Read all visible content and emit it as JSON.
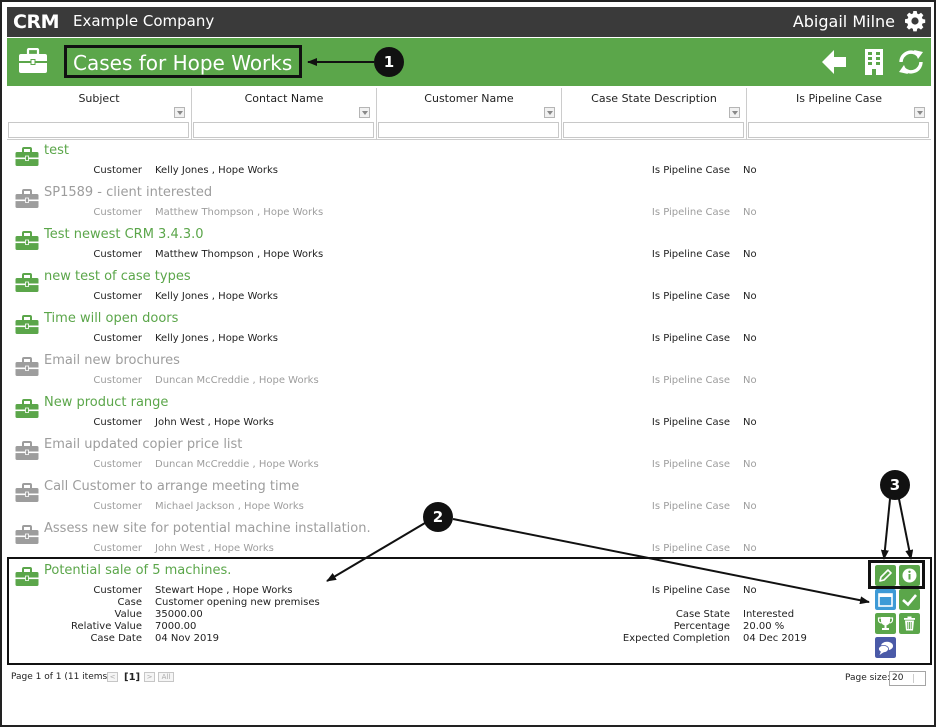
{
  "topbar": {
    "logo": "CRM",
    "company": "Example Company",
    "user": "Abigail Milne"
  },
  "header": {
    "title": "Cases for Hope Works"
  },
  "columns": [
    "Subject",
    "Contact Name",
    "Customer Name",
    "Case State Description",
    "Is Pipeline Case"
  ],
  "labels": {
    "customer": "Customer",
    "pipeline": "Is Pipeline Case",
    "case": "Case",
    "value": "Value",
    "relative_value": "Relative Value",
    "case_date": "Case Date",
    "case_state": "Case State",
    "percentage": "Percentage",
    "expected_completion": "Expected Completion"
  },
  "cases": [
    {
      "title": "test",
      "customer": "Kelly Jones , Hope Works",
      "pipeline": "No",
      "active": true
    },
    {
      "title": "SP1589 - client interested",
      "customer": "Matthew Thompson , Hope Works",
      "pipeline": "No",
      "active": false
    },
    {
      "title": "Test newest CRM 3.4.3.0",
      "customer": "Matthew Thompson , Hope Works",
      "pipeline": "No",
      "active": true
    },
    {
      "title": "new test of case types",
      "customer": "Kelly Jones , Hope Works",
      "pipeline": "No",
      "active": true
    },
    {
      "title": "Time will open doors",
      "customer": "Kelly Jones , Hope Works",
      "pipeline": "No",
      "active": true
    },
    {
      "title": "Email new brochures",
      "customer": "Duncan McCreddie , Hope Works",
      "pipeline": "No",
      "active": false
    },
    {
      "title": "New product range",
      "customer": "John West , Hope Works",
      "pipeline": "No",
      "active": true
    },
    {
      "title": "Email updated copier price list",
      "customer": "Duncan McCreddie , Hope Works",
      "pipeline": "No",
      "active": false
    },
    {
      "title": "Call Customer to arrange meeting time",
      "customer": "Michael Jackson , Hope Works",
      "pipeline": "No",
      "active": false
    },
    {
      "title": "Assess new site for potential machine installation.",
      "customer": "John West , Hope Works",
      "pipeline": "No",
      "active": false
    }
  ],
  "selected_case": {
    "title": "Potential sale of 5 machines.",
    "customer": "Stewart Hope , Hope Works",
    "case": "Customer opening new premises",
    "value": "35000.00",
    "relative_value": "7000.00",
    "case_date": "04 Nov 2019",
    "pipeline": "No",
    "case_state": "Interested",
    "percentage": "20.00 %",
    "expected_completion": "04 Dec 2019"
  },
  "callouts": [
    "1",
    "2",
    "3"
  ],
  "pager": {
    "summary": "Page 1 of 1 (11 items)",
    "current": "[1]",
    "first": "<",
    "next": ">",
    "all": "All",
    "size_label": "Page size:",
    "size": "20"
  },
  "icons": {
    "header_case": "briefcase-icon",
    "back": "arrow-left-icon",
    "company": "building-icon",
    "refresh": "refresh-icon",
    "settings": "gear-icon",
    "case": "briefcase-icon",
    "edit": "pencil-icon",
    "info": "info-icon",
    "calendar": "calendar-icon",
    "complete": "check-icon",
    "win": "trophy-icon",
    "delete": "trash-icon",
    "notes": "speech-bubble-icon"
  },
  "colors": {
    "green": "#5ba64a",
    "dark_bar": "#3a3a3a",
    "inactive": "#9d9d9d",
    "blue_action": "#3e9ad6",
    "purple_action": "#4a5aa8",
    "callout": "#111111"
  }
}
